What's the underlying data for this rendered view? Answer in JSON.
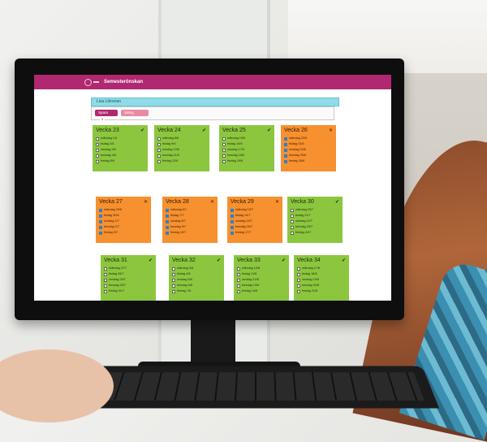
{
  "app": {
    "title": "Semesterönskan",
    "user_name": "Lisa Librarian"
  },
  "toolbar": {
    "save_label": "Spara",
    "save_count": "5",
    "close_label": "Stäng"
  },
  "weeks": [
    {
      "title": "Vecka 23",
      "status": "ok",
      "days": [
        {
          "label": "måndag 1/6",
          "checked": false
        },
        {
          "label": "tisdag 2/6",
          "checked": false
        },
        {
          "label": "onsdag 3/6",
          "checked": false
        },
        {
          "label": "torsdag 4/6",
          "checked": false
        },
        {
          "label": "fredag 5/6",
          "checked": false
        }
      ]
    },
    {
      "title": "Vecka 24",
      "status": "ok",
      "days": [
        {
          "label": "måndag 8/6",
          "checked": false
        },
        {
          "label": "tisdag 9/6",
          "checked": false
        },
        {
          "label": "onsdag 10/6",
          "checked": false
        },
        {
          "label": "torsdag 11/6",
          "checked": false
        },
        {
          "label": "fredag 12/6",
          "checked": false
        }
      ]
    },
    {
      "title": "Vecka 25",
      "status": "ok",
      "days": [
        {
          "label": "måndag 15/6",
          "checked": false
        },
        {
          "label": "tisdag 16/6",
          "checked": false
        },
        {
          "label": "onsdag 17/6",
          "checked": false
        },
        {
          "label": "torsdag 18/6",
          "checked": false
        },
        {
          "label": "fredag 19/6",
          "checked": false
        }
      ]
    },
    {
      "title": "Vecka 26",
      "status": "selected",
      "days": [
        {
          "label": "måndag 22/6",
          "checked": true
        },
        {
          "label": "tisdag 23/6",
          "checked": true
        },
        {
          "label": "onsdag 24/6",
          "checked": true
        },
        {
          "label": "torsdag 25/6",
          "checked": true
        },
        {
          "label": "fredag 26/6",
          "checked": true
        }
      ]
    },
    {
      "title": "Vecka 27",
      "status": "selected",
      "days": [
        {
          "label": "måndag 29/6",
          "checked": true
        },
        {
          "label": "tisdag 30/6",
          "checked": true
        },
        {
          "label": "onsdag 1/7",
          "checked": true
        },
        {
          "label": "torsdag 2/7",
          "checked": true
        },
        {
          "label": "fredag 3/7",
          "checked": true
        }
      ]
    },
    {
      "title": "Vecka 28",
      "status": "selected",
      "days": [
        {
          "label": "måndag 6/7",
          "checked": true
        },
        {
          "label": "tisdag 7/7",
          "checked": true
        },
        {
          "label": "onsdag 8/7",
          "checked": true
        },
        {
          "label": "torsdag 9/7",
          "checked": true
        },
        {
          "label": "fredag 10/7",
          "checked": true
        }
      ]
    },
    {
      "title": "Vecka 29",
      "status": "selected",
      "days": [
        {
          "label": "måndag 13/7",
          "checked": true
        },
        {
          "label": "tisdag 14/7",
          "checked": true
        },
        {
          "label": "onsdag 15/7",
          "checked": true
        },
        {
          "label": "torsdag 16/7",
          "checked": true
        },
        {
          "label": "fredag 17/7",
          "checked": true
        }
      ]
    },
    {
      "title": "Vecka 30",
      "status": "ok",
      "days": [
        {
          "label": "måndag 20/7",
          "checked": false
        },
        {
          "label": "tisdag 21/7",
          "checked": false
        },
        {
          "label": "onsdag 22/7",
          "checked": false
        },
        {
          "label": "torsdag 23/7",
          "checked": false
        },
        {
          "label": "fredag 24/7",
          "checked": false
        }
      ]
    },
    {
      "title": "Vecka 31",
      "status": "ok",
      "days": [
        {
          "label": "måndag 27/7",
          "checked": false
        },
        {
          "label": "tisdag 28/7",
          "checked": false
        },
        {
          "label": "onsdag 29/7",
          "checked": false
        },
        {
          "label": "torsdag 30/7",
          "checked": false
        },
        {
          "label": "fredag 31/7",
          "checked": false
        }
      ]
    },
    {
      "title": "Vecka 32",
      "status": "ok",
      "days": [
        {
          "label": "måndag 3/8",
          "checked": false
        },
        {
          "label": "tisdag 4/8",
          "checked": false
        },
        {
          "label": "onsdag 5/8",
          "checked": false
        },
        {
          "label": "torsdag 6/8",
          "checked": false
        },
        {
          "label": "fredag 7/8",
          "checked": false
        }
      ]
    },
    {
      "title": "Vecka 33",
      "status": "ok",
      "days": [
        {
          "label": "måndag 10/8",
          "checked": false
        },
        {
          "label": "tisdag 11/8",
          "checked": false
        },
        {
          "label": "onsdag 12/8",
          "checked": false
        },
        {
          "label": "torsdag 13/8",
          "checked": false
        },
        {
          "label": "fredag 14/8",
          "checked": false
        }
      ]
    },
    {
      "title": "Vecka 34",
      "status": "ok",
      "days": [
        {
          "label": "måndag 17/8",
          "checked": false
        },
        {
          "label": "tisdag 18/8",
          "checked": false
        },
        {
          "label": "onsdag 19/8",
          "checked": false
        },
        {
          "label": "torsdag 20/8",
          "checked": false
        },
        {
          "label": "fredag 21/8",
          "checked": false
        }
      ]
    }
  ],
  "icons": {
    "ok": "check-circle-icon",
    "selected": "close-icon"
  },
  "colors": {
    "header": "#b0286f",
    "ok_card": "#8cc63e",
    "selected_card": "#f7902f",
    "name_bar": "#8fdbe7"
  }
}
